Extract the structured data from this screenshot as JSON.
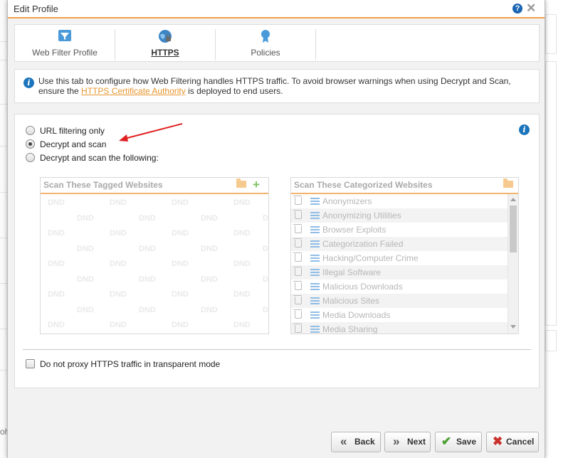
{
  "background": {
    "partial_text": "oh"
  },
  "dialog": {
    "title": "Edit Profile",
    "help_glyph": "?",
    "close_glyph": "✕",
    "tabs": [
      {
        "label": "Web Filter Profile",
        "icon": "funnel-icon",
        "active": false
      },
      {
        "label": "HTTPS",
        "icon": "globe-lock-icon",
        "active": true
      },
      {
        "label": "Policies",
        "icon": "ribbon-icon",
        "active": false
      }
    ],
    "info": {
      "text_before": "Use this tab to configure how Web Filtering handles HTTPS traffic. To avoid browser warnings when using Decrypt and Scan, ensure the ",
      "link": "HTTPS Certificate Authority",
      "text_after": " is deployed to end users.",
      "icon_glyph": "i"
    },
    "options": {
      "info_glyph": "i",
      "radios": [
        {
          "label": "URL filtering only",
          "selected": false
        },
        {
          "label": "Decrypt and scan",
          "selected": true
        },
        {
          "label": "Decrypt and scan the following:",
          "selected": false
        }
      ]
    },
    "tagged": {
      "title": "Scan These Tagged Websites",
      "plus_glyph": "+",
      "placeholder": "DND"
    },
    "categorized": {
      "title": "Scan These Categorized Websites",
      "items": [
        "Anonymizers",
        "Anonymizing Utilities",
        "Browser Exploits",
        "Categorization Failed",
        "Hacking/Computer Crime",
        "Illegal Software",
        "Malicious Downloads",
        "Malicious Sites",
        "Media Downloads",
        "Media Sharing"
      ]
    },
    "checkbox_label": "Do not proxy HTTPS traffic in transparent mode",
    "buttons": {
      "back": "Back",
      "next": "Next",
      "save": "Save",
      "cancel": "Cancel"
    },
    "colors": {
      "accent": "#f0a04b",
      "info": "#1c75bc",
      "link": "#e8952d",
      "save_check": "#4a9f2f",
      "cancel_x": "#c9302c",
      "arrow": "#e02020"
    }
  }
}
